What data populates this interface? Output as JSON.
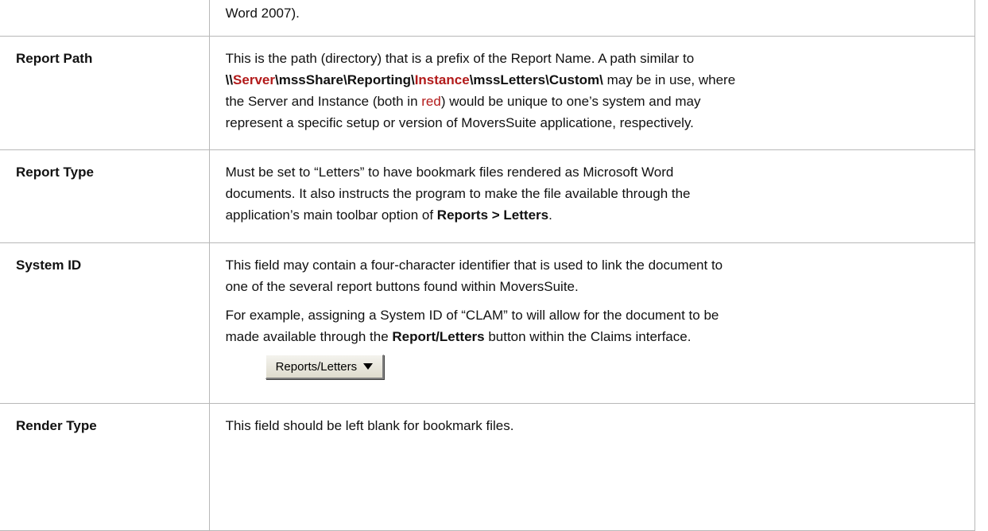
{
  "rows": [
    {
      "field": "",
      "desc": {
        "text": "Word 2007)."
      }
    },
    {
      "field": "Report Path",
      "desc": {
        "l1": "This is the path (directory) that is a prefix of the Report Name.  A path similar to",
        "path_p1": "\\\\",
        "path_server": "Server",
        "path_p2": "\\mssShare\\Reporting\\",
        "path_instance": "Instance",
        "path_p3": "\\mssLetters\\Custom\\",
        "path_after": " may be in use, where",
        "l3_a": "the Server and Instance (both in ",
        "l3_red": "red",
        "l3_b": ") would be unique to one’s system and may",
        "l4": "represent a specific setup or version of MoversSuite applicatione, respectively."
      }
    },
    {
      "field": "Report Type",
      "desc": {
        "l1": "Must be set to “Letters” to have bookmark files rendered as Microsoft Word",
        "l2": "documents.  It also instructs the program to make the file available through the",
        "l3_a": "application’s main toolbar option of ",
        "l3_bold": "Reports > Letters",
        "l3_b": "."
      }
    },
    {
      "field": "System ID",
      "desc": {
        "p1_l1": "This field may contain a four-character identifier that is used to link the document to",
        "p1_l2": "one of the several report buttons found within MoversSuite.",
        "p2_l1": "For example, assigning a System ID of “CLAM” to will allow for the document to be",
        "p2_l2_a": "made available through the ",
        "p2_l2_bold": "Report/Letters",
        "p2_l2_b": " button within the Claims interface.",
        "button_label": "Reports/Letters",
        "button_icon": "caret-down-icon"
      }
    },
    {
      "field": "Render Type",
      "desc": {
        "text": "This field should be left blank for bookmark files."
      }
    }
  ]
}
